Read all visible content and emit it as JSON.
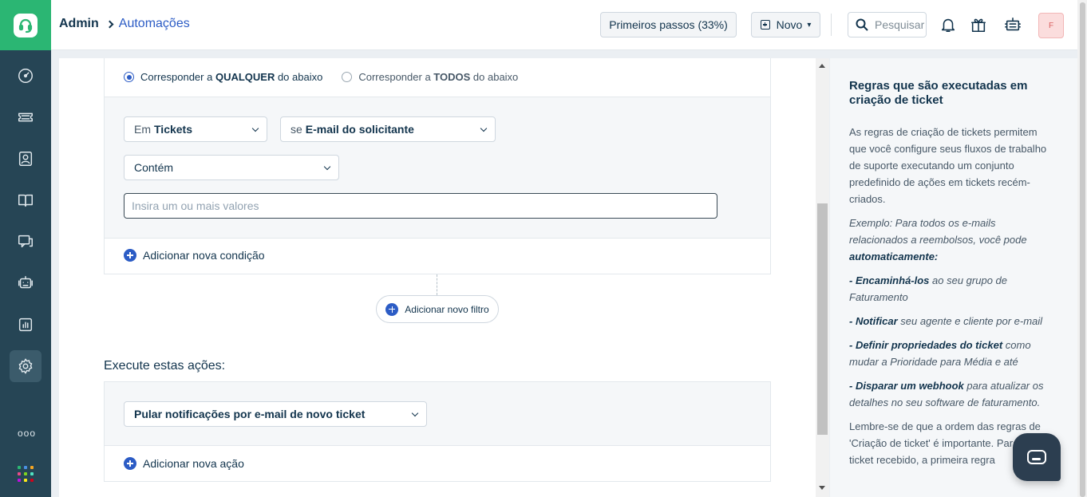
{
  "app": {
    "sidebar_items": [
      {
        "icon": "dashboard-icon",
        "active": false
      },
      {
        "icon": "ticket-icon",
        "active": false
      },
      {
        "icon": "contacts-icon",
        "active": false
      },
      {
        "icon": "book-icon",
        "active": false
      },
      {
        "icon": "chat-icon",
        "active": false
      },
      {
        "icon": "bot-icon",
        "active": false
      },
      {
        "icon": "reports-icon",
        "active": false
      },
      {
        "icon": "gear-icon",
        "active": true
      }
    ],
    "more_label": "ooo",
    "brand_color": "#2bb673",
    "accent_color": "#2c5cc5"
  },
  "header": {
    "breadcrumb_root": "Admin",
    "breadcrumb_current": "Automações",
    "first_steps_label": "Primeiros passos (33%)",
    "new_label": "Novo",
    "search_placeholder": "Pesquisar",
    "avatar_initial": "F"
  },
  "conditions": {
    "match_any_prefix": "Corresponder a ",
    "match_any_bold": "QUALQUER",
    "match_any_suffix": " do abaixo",
    "match_all_prefix": "Corresponder a ",
    "match_all_bold": "TODOS",
    "match_all_suffix": " do abaixo",
    "in_prefix": "Em",
    "in_value": "Tickets",
    "if_prefix": "se",
    "if_value": "E-mail do solicitante",
    "operator_value": "Contém",
    "values_placeholder": "Insira um ou mais valores",
    "add_condition_label": "Adicionar nova condição",
    "add_filter_label": "Adicionar novo filtro"
  },
  "actions": {
    "title": "Execute estas ações:",
    "action_value": "Pular notificações por e-mail de novo ticket",
    "add_action_label": "Adicionar nova ação"
  },
  "help": {
    "title": "Regras que são executadas em criação de ticket",
    "intro": "As regras de criação de tickets permitem que você configure seus fluxos de trabalho de suporte executando um conjunto predefinido de ações em tickets recém-criados.",
    "example_text": "Exemplo: Para todos os e-mails relacionados a reembolsos, você pode ",
    "example_bold": "automaticamente:",
    "b1_bold": "- Encaminhá-los",
    "b1_text": " ao seu grupo de Faturamento",
    "b2_bold": "- Notificar",
    "b2_text": " seu agente e cliente por e-mail",
    "b3_bold": "- Definir propriedades do ticket",
    "b3_text": " como mudar a Prioridade para Média e até",
    "b4_bold": "- Disparar um webhook",
    "b4_text": " para atualizar os detalhes no seu software de faturamento.",
    "note": "Lembre-se de que a ordem das regras de 'Criação de ticket' é importante. Para cada ticket recebido, a primeira regra"
  }
}
